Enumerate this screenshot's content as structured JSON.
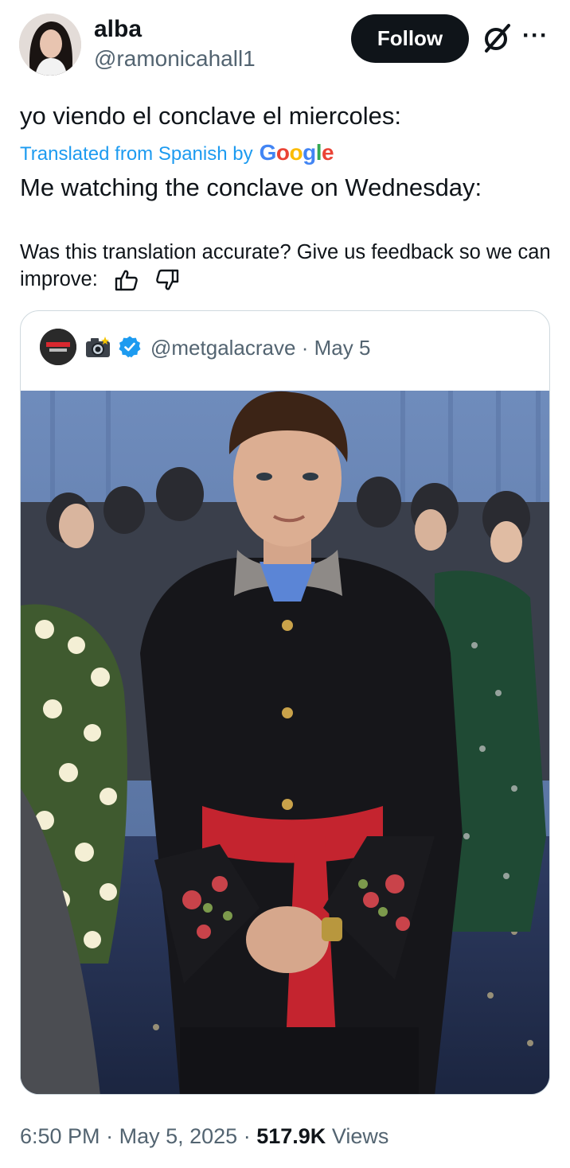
{
  "tweet": {
    "author": {
      "display_name": "alba",
      "handle": "@ramonicahall1"
    },
    "follow_label": "Follow",
    "more_label": "···",
    "original_text": "yo viendo el conclave el miercoles:",
    "translated_from": "Translated from Spanish by",
    "google_letters": [
      {
        "ch": "G",
        "color": "#4285f4"
      },
      {
        "ch": "o",
        "color": "#ea4335"
      },
      {
        "ch": "o",
        "color": "#fbbc05"
      },
      {
        "ch": "g",
        "color": "#4285f4"
      },
      {
        "ch": "l",
        "color": "#34a853"
      },
      {
        "ch": "e",
        "color": "#ea4335"
      }
    ],
    "translation_text": "Me watching the conclave on Wednesday:",
    "feedback_text": "Was this translation accurate? Give us feedback so we can improve:",
    "quoted": {
      "handle": "@metgalacrave",
      "separator": "·",
      "date": "May 5",
      "avatar_text": "metgala crave"
    },
    "footer": {
      "time": "6:50 PM",
      "date": "May 5, 2025",
      "views_count": "517.9K",
      "views_label": "Views"
    }
  },
  "colors": {
    "accent": "#1d9bf0",
    "muted": "#536471",
    "text": "#0f1419",
    "border": "#cfd9de"
  },
  "icons": [
    "grok-icon",
    "more-icon",
    "thumbs-up-icon",
    "thumbs-down-icon",
    "camera-emoji-icon",
    "verified-badge-icon"
  ]
}
